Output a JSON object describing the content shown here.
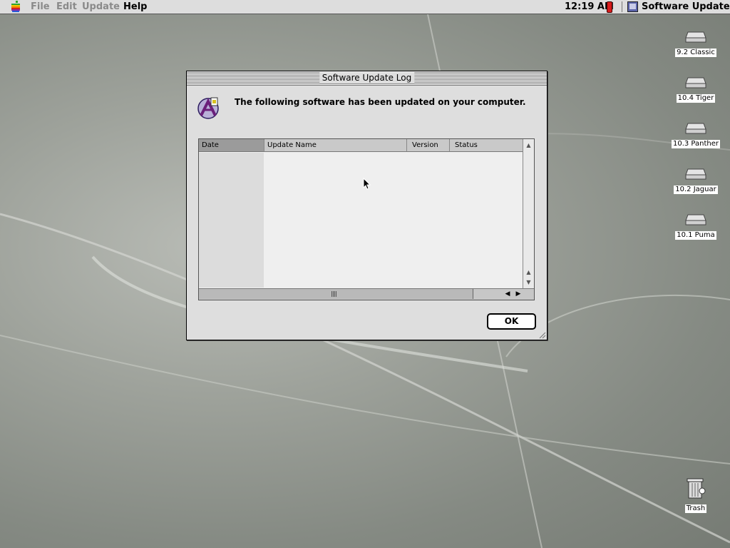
{
  "menubar": {
    "items": [
      "File",
      "Edit",
      "Update",
      "Help"
    ],
    "clock": "12:19 AM",
    "app_name": "Software Update"
  },
  "desktop": {
    "icons": [
      "9.2 Classic",
      "10.4 Tiger",
      "10.3 Panther",
      "10.2 Jaguar",
      "10.1 Puma"
    ],
    "trash": "Trash"
  },
  "dialog": {
    "title": "Software Update Log",
    "message": "The following software has been updated on your computer.",
    "columns": [
      "Date",
      "Update Name",
      "Version",
      "Status"
    ],
    "rows": [],
    "ok_label": "OK"
  },
  "colors": {
    "battery": "#d71c1c",
    "dialog_bg": "#dedede",
    "list_bg": "#efefef"
  }
}
